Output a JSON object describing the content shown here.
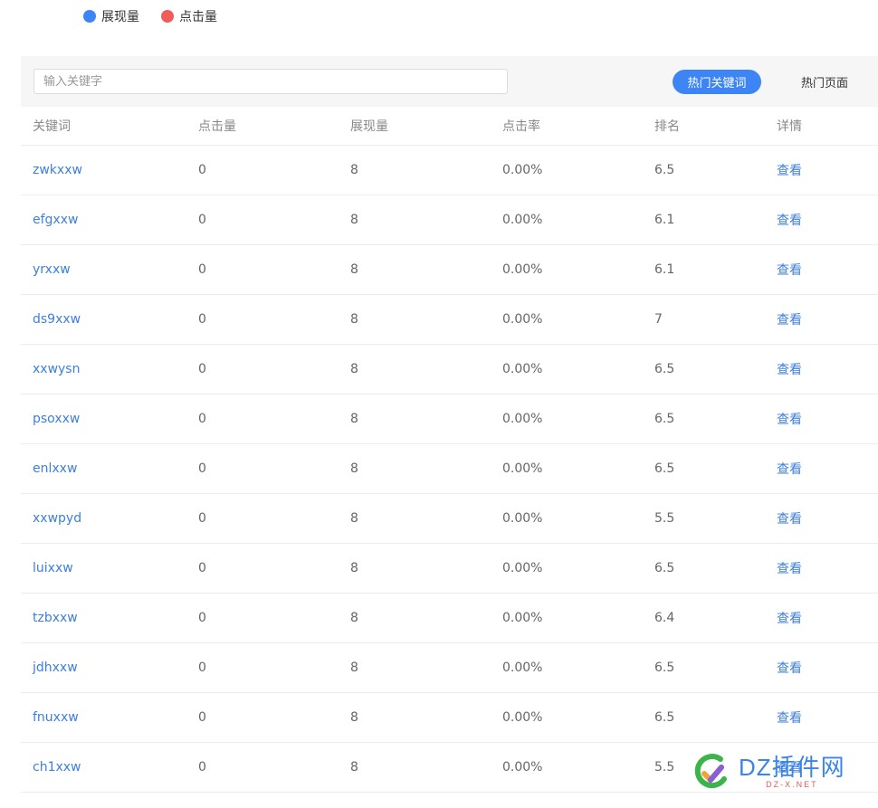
{
  "legend": {
    "items": [
      {
        "label": "展现量",
        "color": "#3d85f5"
      },
      {
        "label": "点击量",
        "color": "#f05c5c"
      }
    ]
  },
  "toolbar": {
    "search_placeholder": "输入关键字",
    "search_value": "",
    "tab_active_label": "热门关键词",
    "tab_inactive_label": "热门页面"
  },
  "colors": {
    "accent": "#3d85f5",
    "link": "#3d7fdc",
    "toolbar_bg": "#f6f6f6"
  },
  "table": {
    "headers": {
      "keyword": "关键词",
      "clicks": "点击量",
      "impressions": "展现量",
      "ctr": "点击率",
      "rank": "排名",
      "detail": "详情"
    },
    "rows": [
      {
        "keyword": "zwkxxw",
        "clicks": "0",
        "impressions": "8",
        "ctr": "0.00%",
        "rank": "6.5",
        "detail": "查看"
      },
      {
        "keyword": "efgxxw",
        "clicks": "0",
        "impressions": "8",
        "ctr": "0.00%",
        "rank": "6.1",
        "detail": "查看"
      },
      {
        "keyword": "yrxxw",
        "clicks": "0",
        "impressions": "8",
        "ctr": "0.00%",
        "rank": "6.1",
        "detail": "查看"
      },
      {
        "keyword": "ds9xxw",
        "clicks": "0",
        "impressions": "8",
        "ctr": "0.00%",
        "rank": "7",
        "detail": "查看"
      },
      {
        "keyword": "xxwysn",
        "clicks": "0",
        "impressions": "8",
        "ctr": "0.00%",
        "rank": "6.5",
        "detail": "查看"
      },
      {
        "keyword": "psoxxw",
        "clicks": "0",
        "impressions": "8",
        "ctr": "0.00%",
        "rank": "6.5",
        "detail": "查看"
      },
      {
        "keyword": "enlxxw",
        "clicks": "0",
        "impressions": "8",
        "ctr": "0.00%",
        "rank": "6.5",
        "detail": "查看"
      },
      {
        "keyword": "xxwpyd",
        "clicks": "0",
        "impressions": "8",
        "ctr": "0.00%",
        "rank": "5.5",
        "detail": "查看"
      },
      {
        "keyword": "luixxw",
        "clicks": "0",
        "impressions": "8",
        "ctr": "0.00%",
        "rank": "6.5",
        "detail": "查看"
      },
      {
        "keyword": "tzbxxw",
        "clicks": "0",
        "impressions": "8",
        "ctr": "0.00%",
        "rank": "6.4",
        "detail": "查看"
      },
      {
        "keyword": "jdhxxw",
        "clicks": "0",
        "impressions": "8",
        "ctr": "0.00%",
        "rank": "6.5",
        "detail": "查看"
      },
      {
        "keyword": "fnuxxw",
        "clicks": "0",
        "impressions": "8",
        "ctr": "0.00%",
        "rank": "6.5",
        "detail": "查看"
      },
      {
        "keyword": "ch1xxw",
        "clicks": "0",
        "impressions": "8",
        "ctr": "0.00%",
        "rank": "5.5",
        "detail": "查看"
      }
    ]
  },
  "watermark": {
    "main": "DZ插件网",
    "sub": "DZ-X.NET"
  }
}
